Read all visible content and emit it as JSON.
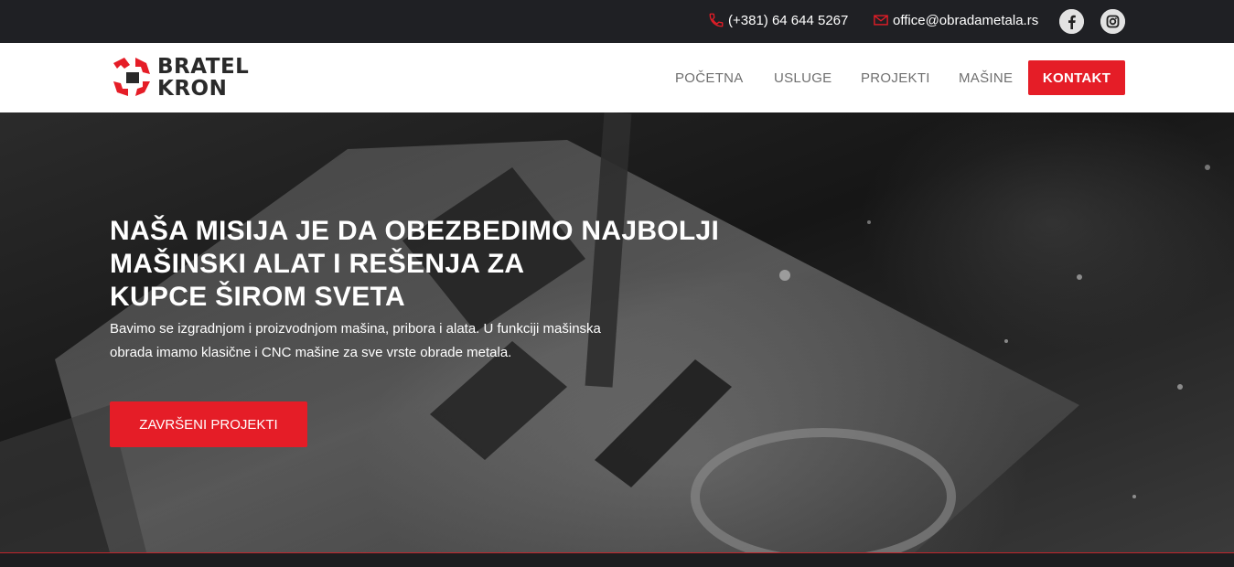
{
  "topbar": {
    "phone": "(+381) 64 644 5267",
    "email": "office@obradametala.rs",
    "social": [
      "facebook-icon",
      "instagram-icon"
    ]
  },
  "header": {
    "logo_line1": "BRATEL",
    "logo_line2": "KRON",
    "nav": {
      "home": "POČETNA",
      "services": "USLUGE",
      "projects": "PROJEKTI",
      "machines": "MAŠINE",
      "contact": "KONTAKT"
    }
  },
  "hero": {
    "title_line1": "NAŠA MISIJA JE DA OBEZBEDIMO NAJBOLJI",
    "title_line2": "MAŠINSKI ALAT I REŠENJA ZA",
    "title_line3": "KUPCE ŠIROM SVETA",
    "text": "Bavimo se izgradnjom i proizvodnjom mašina, pribora i alata. U funkciji mašinska obrada imamo klasične i CNC mašine za sve vrste obrade metala.",
    "button": "ZAVRŠENI PROJEKTI"
  },
  "colors": {
    "accent": "#e51d27",
    "topbar": "#1f2024",
    "header_bg": "#ffffff",
    "nav_text": "#6f6f6f"
  }
}
